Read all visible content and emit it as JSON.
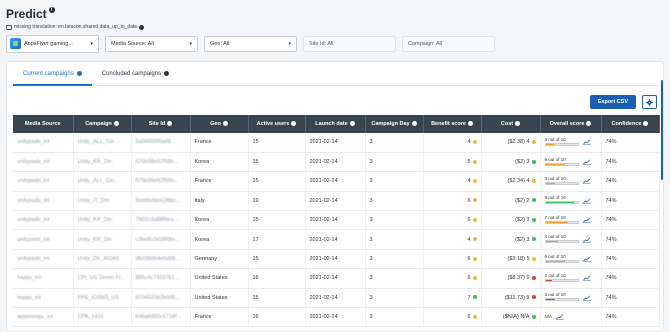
{
  "page": {
    "title": "Predict",
    "warning": "missing translation: en.beacon.shared.data_up_to_date"
  },
  "filters": {
    "app": "AppsFlyer gaming...",
    "media_source": "Media Source: All",
    "geo": "Geo: All",
    "site_id": "Site Id: All",
    "campaign": "Campaign: All"
  },
  "tabs": [
    {
      "label": "Current campaigns",
      "active": true
    },
    {
      "label": "Concluded campaigns",
      "active": false
    }
  ],
  "actions": {
    "export_label": "Export CSV"
  },
  "table": {
    "headers": [
      "Media Source",
      "Campaign",
      "Site Id",
      "Geo",
      "Active users",
      "Launch date",
      "Campaign Day",
      "Benefit score",
      "Cost",
      "Overall score",
      "Confidence"
    ],
    "rows": [
      {
        "media": "unitypads_int",
        "campaign": "Unity_ALL_Glo...",
        "site": "5a04605f9a48...",
        "geo": "France",
        "users": "15",
        "launch": "2021-02-14",
        "day": "3",
        "benefit": "4",
        "benefit_color": "#f0b93a",
        "cost": "($2.38) 4",
        "cost_color": "#f0b93a",
        "overall_text": "3 out of 10",
        "overall": 0.3,
        "overall_color": "#f0a030",
        "confidence": "74%"
      },
      {
        "media": "unitypads_int",
        "campaign": "Unity_KR_Din",
        "site": "676b99e92f98b...",
        "geo": "Korea",
        "users": "15",
        "launch": "2021-02-14",
        "day": "3",
        "benefit": "5",
        "benefit_color": "#f0b93a",
        "cost": "($2) 3",
        "cost_color": "#3cbf5a",
        "overall_text": "6 out of 10",
        "overall": 0.6,
        "overall_color": "#f0a030",
        "confidence": "74%"
      },
      {
        "media": "unitypads_int",
        "campaign": "Unity_ALL_Glo...",
        "site": "676b99e92f98b...",
        "geo": "France",
        "users": "15",
        "launch": "2021-02-14",
        "day": "3",
        "benefit": "4",
        "benefit_color": "#f0b93a",
        "cost": "($2.34) 4",
        "cost_color": "#f0b93a",
        "overall_text": "3 out of 10",
        "overall": 0.3,
        "overall_color": "#f0a030",
        "confidence": "74%"
      },
      {
        "media": "unitypads_int",
        "campaign": "Unity_IT_Din",
        "site": "5bdd6ddee2f8bc...",
        "geo": "Italy",
        "users": "19",
        "launch": "2021-02-14",
        "day": "3",
        "benefit": "6",
        "benefit_color": "#f0b93a",
        "cost": "($2) 2",
        "cost_color": "#3cbf5a",
        "overall_text": "9 out of 10",
        "overall": 0.9,
        "overall_color": "#3cbf5a",
        "confidence": "74%"
      },
      {
        "media": "unitypads_int",
        "campaign": "Unity_KR_Din",
        "site": "7902c3a88f9ea...",
        "geo": "Korea",
        "users": "15",
        "launch": "2021-02-14",
        "day": "3",
        "benefit": "6",
        "benefit_color": "#f0b93a",
        "cost": "($2) 3",
        "cost_color": "#3cbf5a",
        "overall_text": "7 out of 10",
        "overall": 0.7,
        "overall_color": "#f0a030",
        "confidence": "74%"
      },
      {
        "media": "unitypads_int",
        "campaign": "Unity_KR_Din",
        "site": "c3be8c0d38f0fe...",
        "geo": "Korea",
        "users": "17",
        "launch": "2021-02-14",
        "day": "3",
        "benefit": "4",
        "benefit_color": "#f0b93a",
        "cost": "($2) 3",
        "cost_color": "#3cbf5a",
        "overall_text": "4 out of 10",
        "overall": 0.4,
        "overall_color": "#f0a030",
        "confidence": "74%"
      },
      {
        "media": "unitypads_int",
        "campaign": "Unity_DE_ROAS",
        "site": "d5038d64e5d98...",
        "geo": "Germany",
        "users": "15",
        "launch": "2021-02-14",
        "day": "3",
        "benefit": "6",
        "benefit_color": "#f0b93a",
        "cost": "($3.18) 5",
        "cost_color": "#f0b93a",
        "overall_text": "6 out of 10",
        "overall": 0.6,
        "overall_color": "#f0a030",
        "confidence": "74%"
      },
      {
        "media": "happy_int",
        "campaign": "CPI_US Green Fi...",
        "site": "885c4c74037b1...",
        "geo": "United States",
        "users": "16",
        "launch": "2021-02-14",
        "day": "3",
        "benefit": "6",
        "benefit_color": "#f0b93a",
        "cost": "($8.37) 9",
        "cost_color": "#e0393e",
        "overall_text": "2 out of 10",
        "overall": 0.2,
        "overall_color": "#e0393e",
        "confidence": "74%"
      },
      {
        "media": "happy_int",
        "campaign": "PPE_iOSNS_US",
        "site": "8794033d2b9d6...",
        "geo": "United States",
        "users": "15",
        "launch": "2021-02-14",
        "day": "3",
        "benefit": "7",
        "benefit_color": "#3cbf5a",
        "cost": "($11.73) 9",
        "cost_color": "#e0393e",
        "overall_text": "3 out of 10",
        "overall": 0.3,
        "overall_color": "#e0393e",
        "confidence": "74%"
      },
      {
        "media": "appsnoopy_int",
        "campaign": "CPA_1415",
        "site": "646a6d55c5718f...",
        "geo": "France",
        "users": "16",
        "launch": "2021-02-14",
        "day": "3",
        "benefit": "6",
        "benefit_color": "#f0b93a",
        "cost": "($N/A) N/A",
        "cost_color": "#3cbf5a",
        "overall_text": "N/A",
        "overall": 0,
        "overall_color": "#ffffff",
        "confidence": "74%"
      }
    ]
  },
  "colors": {
    "accent": "#1a5fb4",
    "header_bg": "#3a4450"
  },
  "icons": {
    "gear": "gear-icon",
    "info": "info-icon",
    "trend": "trend-chart-icon"
  }
}
